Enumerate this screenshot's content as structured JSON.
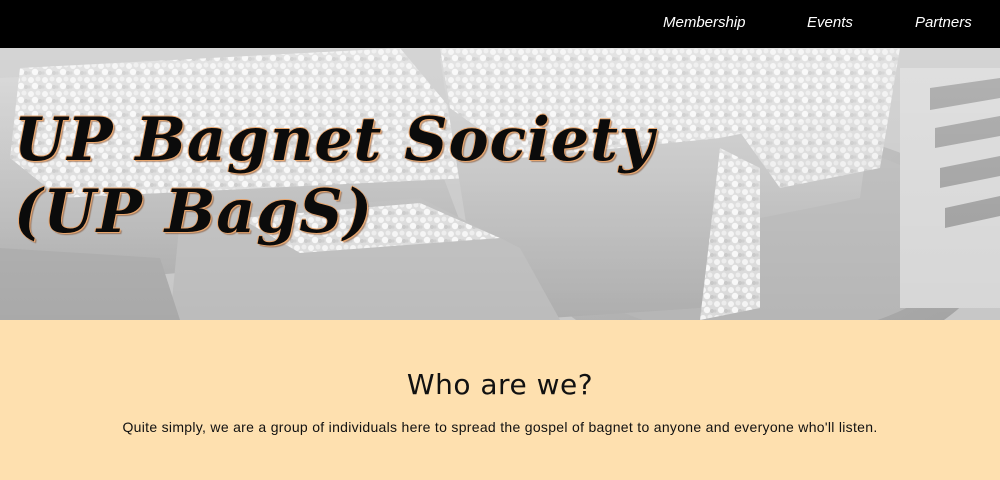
{
  "nav": {
    "items": [
      {
        "label": "Membership"
      },
      {
        "label": "Events"
      },
      {
        "label": "Partners"
      }
    ]
  },
  "hero": {
    "title_line1": "UP Bagnet Society",
    "title_line2": "(UP BagS)"
  },
  "about": {
    "heading": "Who are we?",
    "text": "Quite simply, we are a group of individuals here to spread the gospel of bagnet to anyone and everyone who'll listen."
  },
  "colors": {
    "nav_background": "#000000",
    "nav_text": "#ffffff",
    "section_background": "#fee0af",
    "title_text": "#0b0b0b",
    "title_outline": "#e8a66e"
  }
}
